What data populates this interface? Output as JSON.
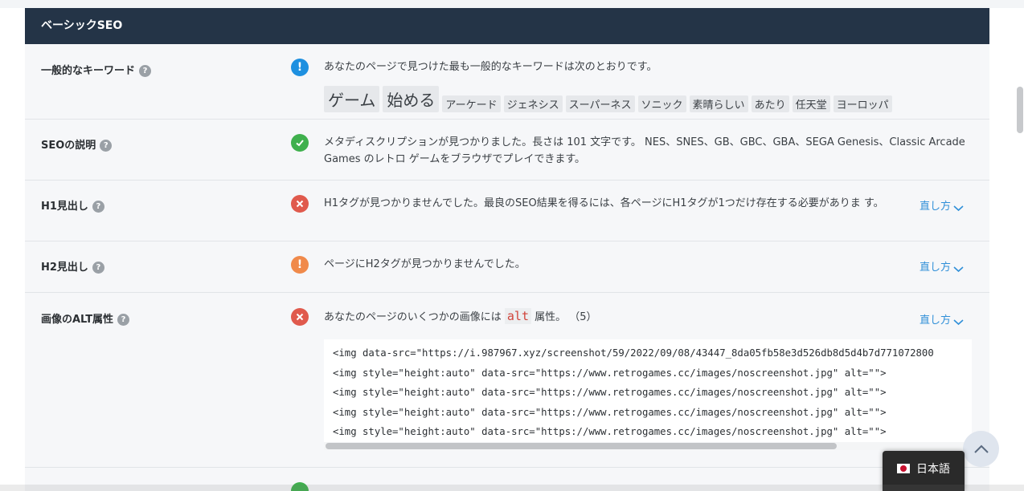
{
  "section": {
    "title": "ベーシックSEO"
  },
  "rows": {
    "keywords": {
      "label": "一般的なキーワード",
      "message": "あなたのページで見つけた最も一般的なキーワードは次のとおりです。",
      "keywords": [
        "ゲーム",
        "始める",
        "アーケード",
        "ジェネシス",
        "スーパーネス",
        "ソニック",
        "素晴らしい",
        "あたり",
        "任天堂",
        "ヨーロッパ"
      ]
    },
    "description": {
      "label": "SEOの説明",
      "message": "メタディスクリプションが見つかりました。長さは 101 文字です。 NES、SNES、GB、GBC、GBA、SEGA Genesis、Classic Arcade Games のレトロ ゲームをブラウザでプレイできます。"
    },
    "h1": {
      "label": "H1見出し",
      "message": "H1タグが見つかりませんでした。最良のSEO結果を得るには、各ページにH1タグが1つだけ存在する必要がありま す。",
      "howto": "直し方"
    },
    "h2": {
      "label": "H2見出し",
      "message": "ページにH2タグが見つかりませんでした。",
      "howto": "直し方"
    },
    "alt": {
      "label": "画像のALT属性",
      "message_pre": "あなたのページのいくつかの画像には",
      "code": "alt",
      "message_post": "属性。 （5）",
      "howto": "直し方",
      "code_lines": [
        "<img data-src=\"https://i.987967.xyz/screenshot/59/2022/09/08/43447_8da05fb58e3d526db8d5d4b7d771072800",
        "<img style=\"height:auto\" data-src=\"https://www.retrogames.cc/images/noscreenshot.jpg\" alt=\"\">",
        "<img style=\"height:auto\" data-src=\"https://www.retrogames.cc/images/noscreenshot.jpg\" alt=\"\">",
        "<img style=\"height:auto\" data-src=\"https://www.retrogames.cc/images/noscreenshot.jpg\" alt=\"\">",
        "<img style=\"height:auto\" data-src=\"https://www.retrogames.cc/images/noscreenshot.jpg\" alt=\"\">"
      ]
    }
  },
  "help_symbol": "?",
  "language": {
    "label": "日本語"
  },
  "colors": {
    "header_bg": "#243447",
    "info": "#1e90e0",
    "ok": "#3fb04d",
    "error": "#e05a4d",
    "warning": "#f08a4b",
    "link": "#2f8fd8"
  },
  "icons": {
    "info": "exclamation-circle-icon",
    "ok": "check-circle-icon",
    "error": "x-circle-icon",
    "warning": "exclamation-circle-icon",
    "scroll_top": "chevron-up-icon"
  }
}
